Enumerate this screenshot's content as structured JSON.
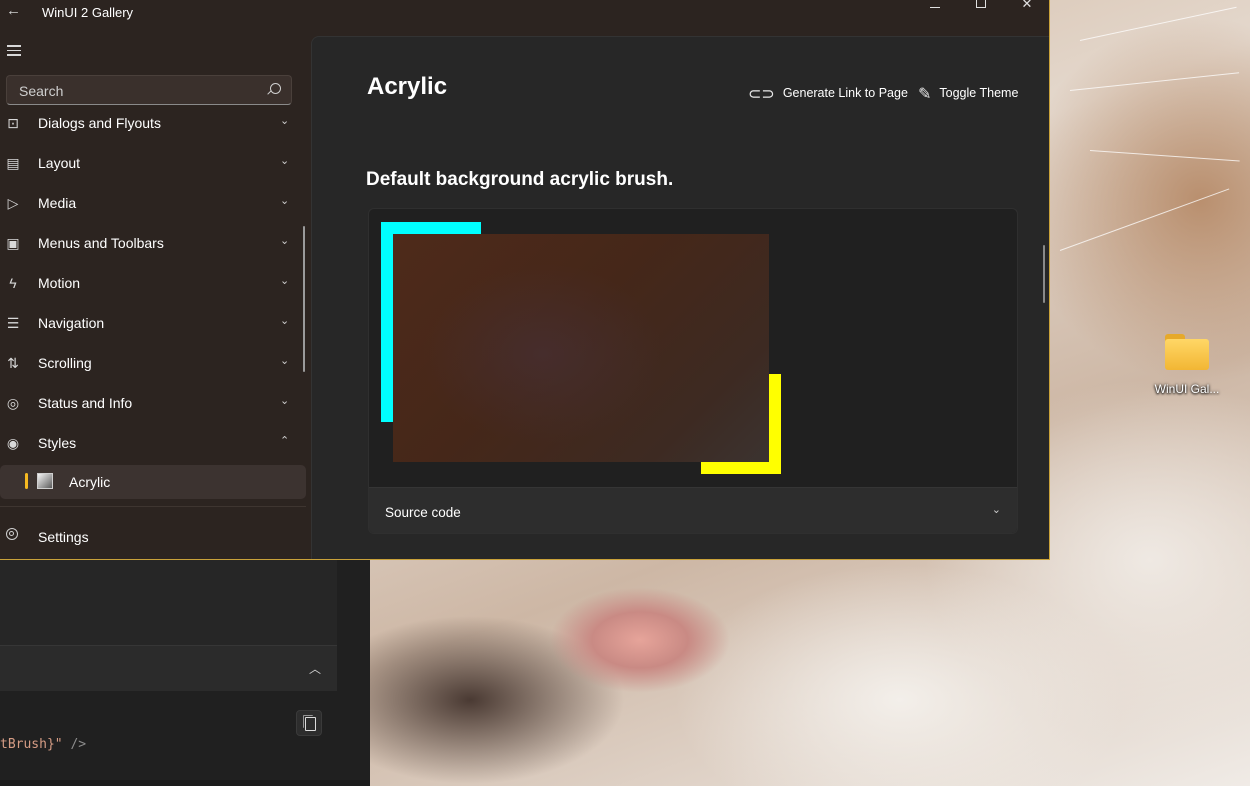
{
  "window": {
    "title": "WinUI 2 Gallery",
    "back_glyph": "←",
    "minimize_glyph": "",
    "close_glyph": "✕"
  },
  "nav": {
    "search_placeholder": "Search",
    "items": [
      {
        "label": "Dialogs and Flyouts",
        "icon": "chat-bubble-icon",
        "glyph": "⊡",
        "chevron": "⌄"
      },
      {
        "label": "Layout",
        "icon": "layout-icon",
        "glyph": "▤",
        "chevron": "⌄"
      },
      {
        "label": "Media",
        "icon": "media-icon",
        "glyph": "▷",
        "chevron": "⌄"
      },
      {
        "label": "Menus and Toolbars",
        "icon": "save-icon",
        "glyph": "▣",
        "chevron": "⌄"
      },
      {
        "label": "Motion",
        "icon": "lightning-icon",
        "glyph": "ϟ",
        "chevron": "⌄"
      },
      {
        "label": "Navigation",
        "icon": "navigation-icon",
        "glyph": "☰",
        "chevron": "⌄"
      },
      {
        "label": "Scrolling",
        "icon": "sort-icon",
        "glyph": "⇅",
        "chevron": "⌄"
      },
      {
        "label": "Status and Info",
        "icon": "chat-icon",
        "glyph": "◎",
        "chevron": "⌄"
      },
      {
        "label": "Styles",
        "icon": "palette-icon",
        "glyph": "◉",
        "chevron": "⌃"
      }
    ],
    "selected_item": {
      "label": "Acrylic",
      "icon": "acrylic-icon"
    },
    "settings_label": "Settings",
    "selection_color": "#f5b921"
  },
  "content": {
    "page_title": "Acrylic",
    "generate_link_label": "Generate Link to Page",
    "toggle_theme_label": "Toggle Theme",
    "section_title": "Default background acrylic brush.",
    "source_code_label": "Source code",
    "sample_colors": {
      "cyan": "#00ffff",
      "yellow": "#ffff00"
    }
  },
  "background_window": {
    "code_string": "tBrush}\"",
    "code_tag": " />"
  },
  "desktop": {
    "icon_label": "WinUI Gal..."
  }
}
